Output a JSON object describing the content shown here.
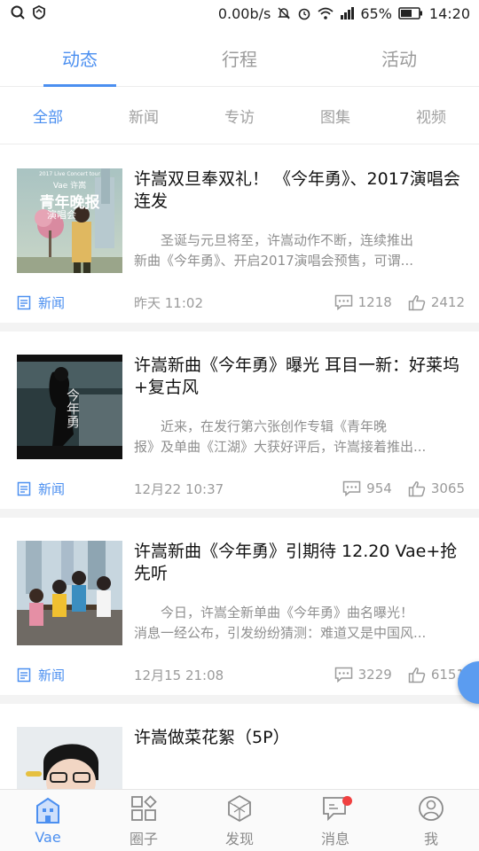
{
  "status_bar": {
    "net_speed": "0.00b/s",
    "battery": "65%",
    "time": "14:20"
  },
  "main_tabs": [
    {
      "label": "动态",
      "active": true
    },
    {
      "label": "行程",
      "active": false
    },
    {
      "label": "活动",
      "active": false
    }
  ],
  "sub_tabs": [
    {
      "label": "全部",
      "active": true
    },
    {
      "label": "新闻",
      "active": false
    },
    {
      "label": "专访",
      "active": false
    },
    {
      "label": "图集",
      "active": false
    },
    {
      "label": "视频",
      "active": false
    }
  ],
  "articles": [
    {
      "title": "许嵩双旦奉双礼！ 《今年勇》、2017演唱会连发",
      "summary_line1": "圣诞与元旦将至，许嵩动作不断，连续推出",
      "summary_line2": "新曲《今年勇》、开启2017演唱会预售，可谓...",
      "tag": "新闻",
      "time": "昨天 11:02",
      "comments": "1218",
      "likes": "2412",
      "thumb_text_top": "2017 Live Concert tour",
      "thumb_text_brand": "Vae 许嵩",
      "thumb_text_title": "青年晚报",
      "thumb_text_sub": "演唱会"
    },
    {
      "title": "许嵩新曲《今年勇》曝光 耳目一新：好莱坞+复古风",
      "summary_line1": "近来，在发行第六张创作专辑《青年晚",
      "summary_line2": "报》及单曲《江湖》大获好评后，许嵩接着推出...",
      "tag": "新闻",
      "time": "12月22 10:37",
      "comments": "954",
      "likes": "3065",
      "thumb_text_title": "今年勇"
    },
    {
      "title": "许嵩新曲《今年勇》引期待 12.20 Vae+抢先听",
      "summary_line1": "今日，许嵩全新单曲《今年勇》曲名曝光！",
      "summary_line2": "消息一经公布，引发纷纷猜测：难道又是中国风...",
      "tag": "新闻",
      "time": "12月15 21:08",
      "comments": "3229",
      "likes": "6151"
    },
    {
      "title": "许嵩做菜花絮（5P）"
    }
  ],
  "bottom_nav": [
    {
      "label": "Vae",
      "icon": "home-icon",
      "active": true
    },
    {
      "label": "圈子",
      "icon": "grid-icon",
      "active": false
    },
    {
      "label": "发现",
      "icon": "discover-icon",
      "active": false
    },
    {
      "label": "消息",
      "icon": "message-icon",
      "active": false,
      "badge": true
    },
    {
      "label": "我",
      "icon": "profile-icon",
      "active": false
    }
  ],
  "colors": {
    "accent": "#4b8ff0",
    "badge": "#f04040",
    "muted": "#9b9b9b"
  }
}
